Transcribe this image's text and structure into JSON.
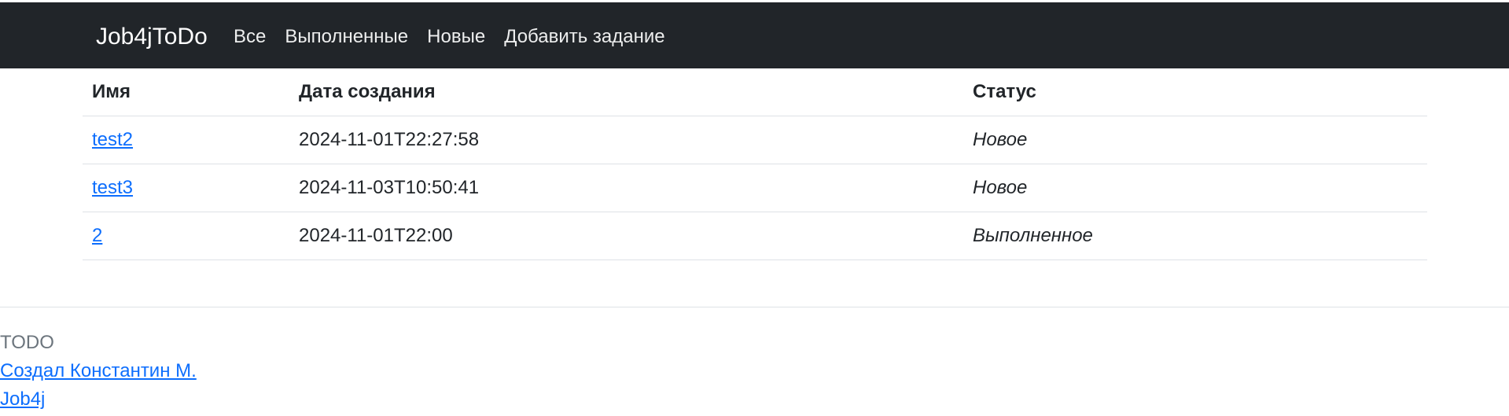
{
  "navbar": {
    "brand": "Job4jToDo",
    "links": [
      "Все",
      "Выполненные",
      "Новые",
      "Добавить задание"
    ]
  },
  "table": {
    "headers": [
      "Имя",
      "Дата создания",
      "Статус"
    ],
    "rows": [
      {
        "name": "test2",
        "date": "2024-11-01T22:27:58",
        "status": "Новое"
      },
      {
        "name": "test3",
        "date": "2024-11-03T10:50:41",
        "status": "Новое"
      },
      {
        "name": "2",
        "date": "2024-11-01T22:00",
        "status": "Выполненное"
      }
    ]
  },
  "footer": {
    "title": "TODO",
    "author_link": "Создал Константин М.",
    "job4j_link": "Job4j"
  },
  "colors": {
    "navbar_bg": "#212529",
    "link": "#0d6efd",
    "muted": "#6c757d"
  }
}
